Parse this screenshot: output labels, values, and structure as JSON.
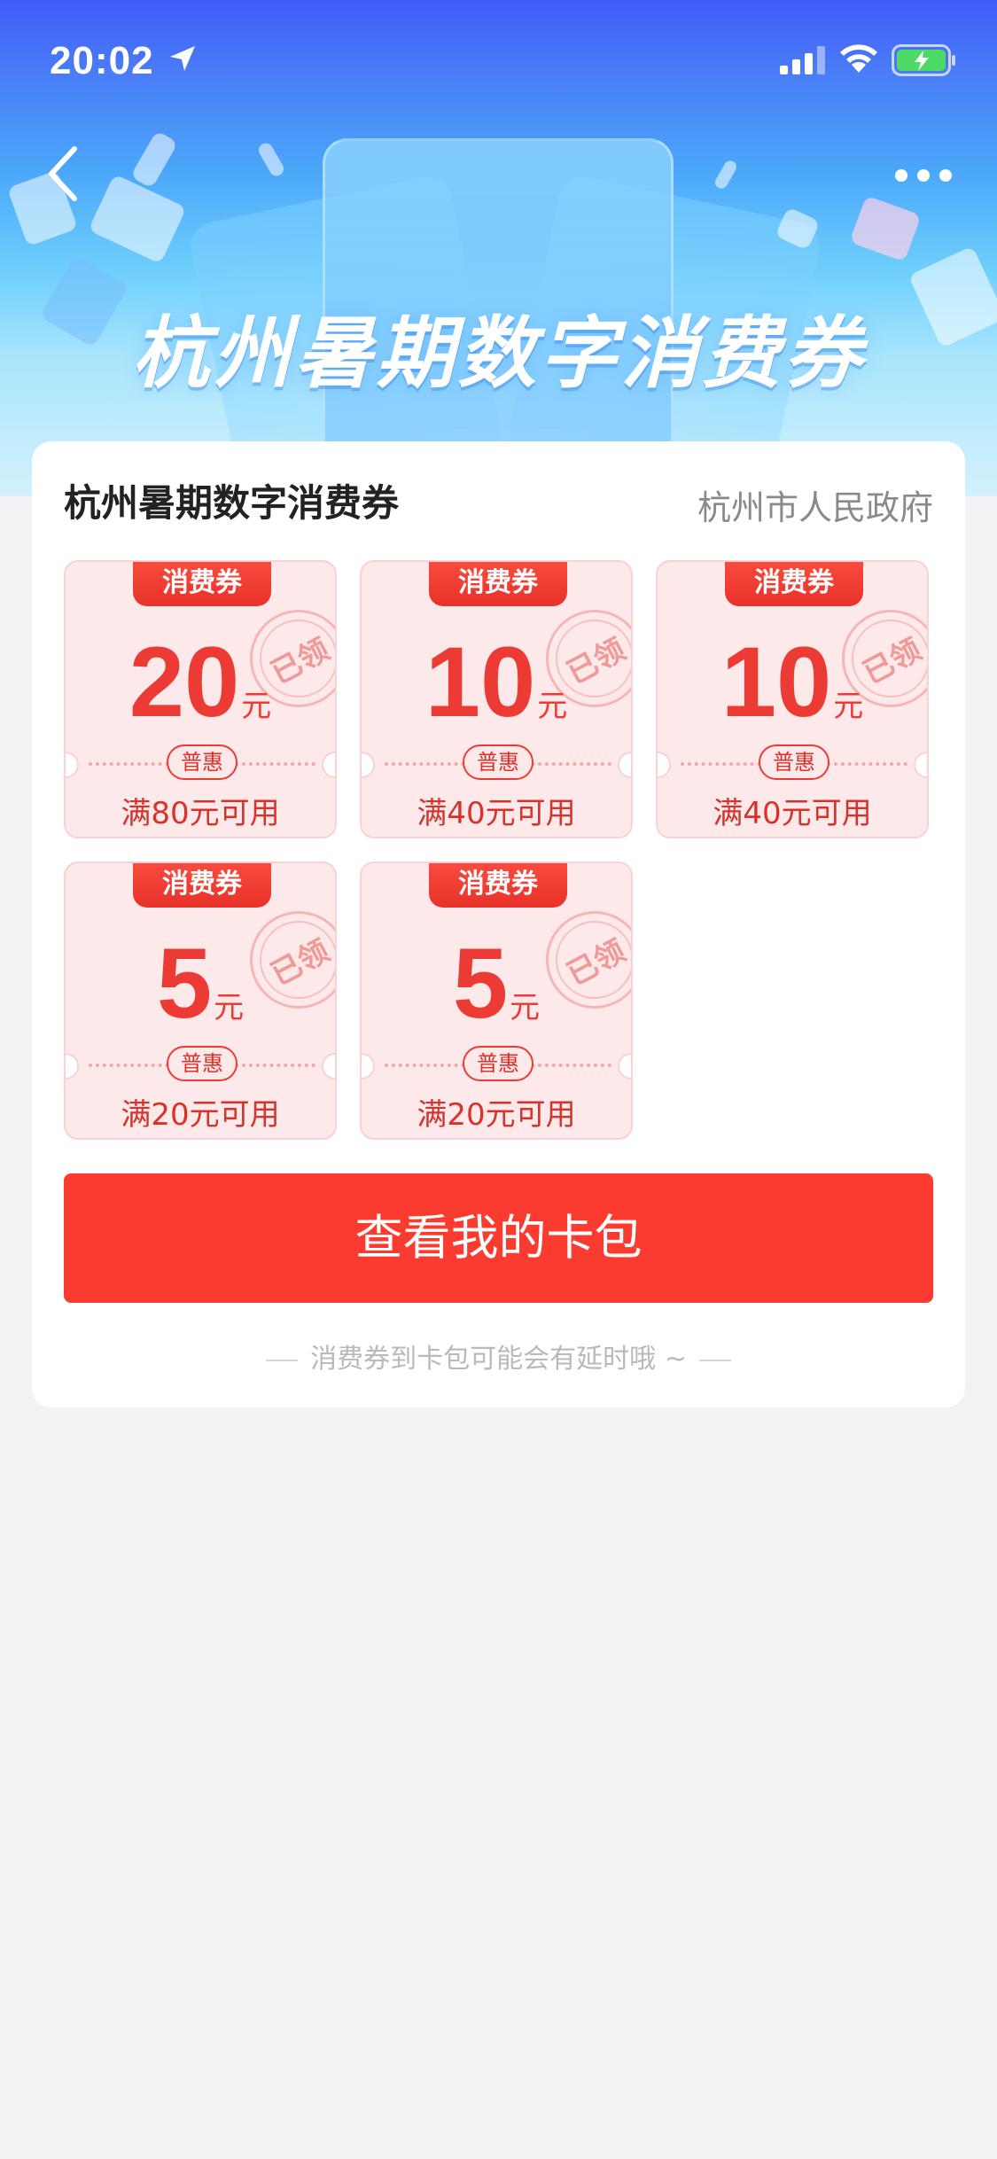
{
  "status_bar": {
    "time": "20:02"
  },
  "banner": {
    "title": "杭州暑期数字消费券"
  },
  "card": {
    "title": "杭州暑期数字消费券",
    "issuer": "杭州市人民政府",
    "coupons": [
      {
        "tag": "消费券",
        "amount": "20",
        "unit": "元",
        "badge": "普惠",
        "condition": "满80元可用",
        "stamp": "已领"
      },
      {
        "tag": "消费券",
        "amount": "10",
        "unit": "元",
        "badge": "普惠",
        "condition": "满40元可用",
        "stamp": "已领"
      },
      {
        "tag": "消费券",
        "amount": "10",
        "unit": "元",
        "badge": "普惠",
        "condition": "满40元可用",
        "stamp": "已领"
      },
      {
        "tag": "消费券",
        "amount": "5",
        "unit": "元",
        "badge": "普惠",
        "condition": "满20元可用",
        "stamp": "已领"
      },
      {
        "tag": "消费券",
        "amount": "5",
        "unit": "元",
        "badge": "普惠",
        "condition": "满20元可用",
        "stamp": "已领"
      }
    ],
    "button_label": "查看我的卡包",
    "footnote": "消费券到卡包可能会有延时哦 ~"
  },
  "colors": {
    "accent": "#fb3b30",
    "coupon_bg": "#fde9e9",
    "coupon_text": "#ec3b34",
    "banner_top": "#3f5cf8"
  },
  "icons": {
    "back": "chevron-left-icon",
    "more": "more-dots-icon",
    "location": "location-arrow-icon",
    "signal": "signal-icon",
    "wifi": "wifi-icon",
    "battery": "battery-charging-icon"
  }
}
